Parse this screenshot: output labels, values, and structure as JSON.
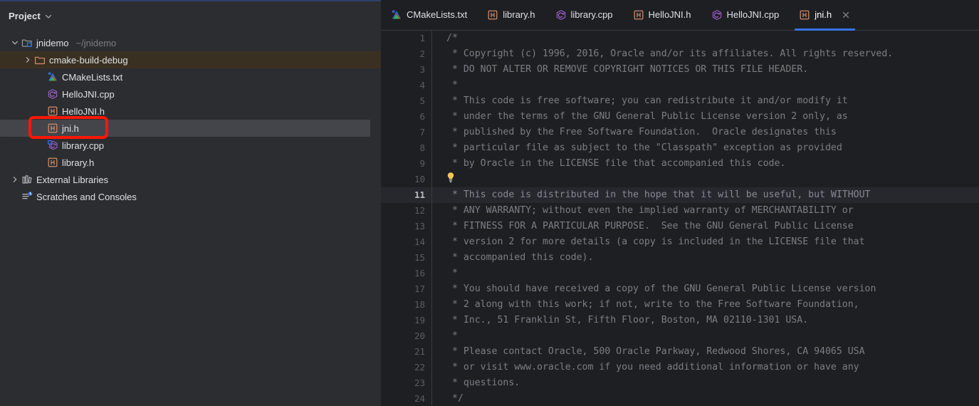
{
  "theme": {
    "sidebar_bg": "#2b2d30",
    "editor_bg": "#1e1f22",
    "accent": "#3574f0",
    "annotation": "#fc1703",
    "selected_row": "#43454a",
    "excluded_row": "#3a3022",
    "text": "#dfe1e5",
    "muted_text": "#7a7e85"
  },
  "sidebar": {
    "title": "Project",
    "title_chevron_icon": "chevron-down-icon",
    "tree": [
      {
        "label": "jnidemo",
        "sub": "~/jnidemo",
        "icon": "project-module-folder-icon",
        "indent": 0,
        "twisty": "chevron-down-icon",
        "state": "normal"
      },
      {
        "label": "cmake-build-debug",
        "sub": "",
        "icon": "folder-excluded-icon",
        "indent": 1,
        "twisty": "chevron-right-icon",
        "state": "excluded"
      },
      {
        "label": "CMakeLists.txt",
        "sub": "",
        "icon": "cmake-file-icon",
        "indent": 2,
        "twisty": "",
        "state": "normal"
      },
      {
        "label": "HelloJNI.cpp",
        "sub": "",
        "icon": "cpp-source-file-icon",
        "indent": 2,
        "twisty": "",
        "state": "normal"
      },
      {
        "label": "HelloJNI.h",
        "sub": "",
        "icon": "header-file-icon",
        "indent": 2,
        "twisty": "",
        "state": "normal"
      },
      {
        "label": "jni.h",
        "sub": "",
        "icon": "header-file-icon",
        "indent": 2,
        "twisty": "",
        "state": "selected"
      },
      {
        "label": "library.cpp",
        "sub": "",
        "icon": "cpp-source-library-file-icon",
        "indent": 2,
        "twisty": "",
        "state": "normal"
      },
      {
        "label": "library.h",
        "sub": "",
        "icon": "header-file-icon",
        "indent": 2,
        "twisty": "",
        "state": "normal"
      },
      {
        "label": "External Libraries",
        "sub": "",
        "icon": "external-libraries-icon",
        "indent": 0,
        "twisty": "chevron-right-icon",
        "state": "normal"
      },
      {
        "label": "Scratches and Consoles",
        "sub": "",
        "icon": "scratches-icon",
        "indent": 0,
        "twisty": "",
        "state": "normal"
      }
    ],
    "annotation": {
      "shape": "rounded-rectangle",
      "color": "#fc1703",
      "targets": "jni.h"
    }
  },
  "editor": {
    "tabs": [
      {
        "label": "CMakeLists.txt",
        "icon": "cmake-file-icon",
        "active": false,
        "closable": false
      },
      {
        "label": "library.h",
        "icon": "header-file-icon",
        "active": false,
        "closable": false
      },
      {
        "label": "library.cpp",
        "icon": "cpp-source-file-icon",
        "active": false,
        "closable": false
      },
      {
        "label": "HelloJNI.h",
        "icon": "header-file-icon",
        "active": false,
        "closable": false
      },
      {
        "label": "HelloJNI.cpp",
        "icon": "cpp-source-file-icon",
        "active": false,
        "closable": false
      },
      {
        "label": "jni.h",
        "icon": "header-file-icon",
        "active": true,
        "closable": true,
        "close_icon": "close-icon"
      }
    ],
    "caret_line": 11,
    "intention_bulb": {
      "icon": "lightbulb-icon",
      "line": 10
    },
    "lines": [
      {
        "n": "1",
        "text": "/*"
      },
      {
        "n": "2",
        "text": " * Copyright (c) 1996, 2016, Oracle and/or its affiliates. All rights reserved."
      },
      {
        "n": "3",
        "text": " * DO NOT ALTER OR REMOVE COPYRIGHT NOTICES OR THIS FILE HEADER."
      },
      {
        "n": "4",
        "text": " *"
      },
      {
        "n": "5",
        "text": " * This code is free software; you can redistribute it and/or modify it"
      },
      {
        "n": "6",
        "text": " * under the terms of the GNU General Public License version 2 only, as"
      },
      {
        "n": "7",
        "text": " * published by the Free Software Foundation.  Oracle designates this"
      },
      {
        "n": "8",
        "text": " * particular file as subject to the \"Classpath\" exception as provided"
      },
      {
        "n": "9",
        "text": " * by Oracle in the LICENSE file that accompanied this code."
      },
      {
        "n": "10",
        "text": ""
      },
      {
        "n": "11",
        "text": " * This code is distributed in the hope that it will be useful, but WITHOUT"
      },
      {
        "n": "12",
        "text": " * ANY WARRANTY; without even the implied warranty of MERCHANTABILITY or"
      },
      {
        "n": "13",
        "text": " * FITNESS FOR A PARTICULAR PURPOSE.  See the GNU General Public License"
      },
      {
        "n": "14",
        "text": " * version 2 for more details (a copy is included in the LICENSE file that"
      },
      {
        "n": "15",
        "text": " * accompanied this code)."
      },
      {
        "n": "16",
        "text": " *"
      },
      {
        "n": "17",
        "text": " * You should have received a copy of the GNU General Public License version"
      },
      {
        "n": "18",
        "text": " * 2 along with this work; if not, write to the Free Software Foundation,"
      },
      {
        "n": "19",
        "text": " * Inc., 51 Franklin St, Fifth Floor, Boston, MA 02110-1301 USA."
      },
      {
        "n": "20",
        "text": " *"
      },
      {
        "n": "21",
        "text": " * Please contact Oracle, 500 Oracle Parkway, Redwood Shores, CA 94065 USA"
      },
      {
        "n": "22",
        "text": " * or visit www.oracle.com if you need additional information or have any"
      },
      {
        "n": "23",
        "text": " * questions."
      },
      {
        "n": "24",
        "text": " */"
      }
    ]
  }
}
